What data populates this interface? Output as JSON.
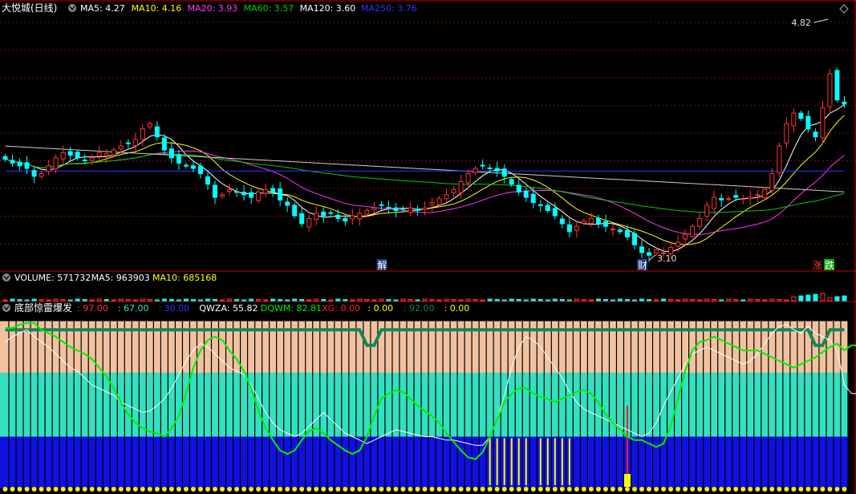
{
  "colors": {
    "ma5": "#ffffff",
    "ma10": "#ffff00",
    "ma20": "#ff33ff",
    "ma60": "#00cc00",
    "ma120": "#cccccc",
    "ma250": "#3333ff",
    "up": "#ff3333",
    "down": "#00ffff",
    "border": "#c00000",
    "peach": "#f2c2a0",
    "teal": "#33e0c0",
    "blue": "#1010e0",
    "qwza": "#ffffff",
    "dqwm": "#00ee00",
    "xg": "#ff2020",
    "flat": "#118855",
    "spike": "#ffff00",
    "dot": "#ffee00"
  },
  "main_panel": {
    "stock_name": "大悦城(日线)",
    "indicators": [
      {
        "label": "MA5: 4.27",
        "color": "#ffffff"
      },
      {
        "label": "MA10: 4.16",
        "color": "#ffff00"
      },
      {
        "label": "MA20: 3.93",
        "color": "#ff33ff"
      },
      {
        "label": "MA60: 3.57",
        "color": "#00cc00"
      },
      {
        "label": "MA120: 3.60",
        "color": "#ffffff"
      },
      {
        "label": "MA250: 3.76",
        "color": "#3333ff"
      }
    ],
    "high_label": "4.82",
    "low_label": "3.10",
    "marker_jie": "解",
    "marker_cai": "财",
    "marker_zhang": "涨",
    "marker_die": "跌"
  },
  "volume_panel": {
    "labels": [
      {
        "label": "VOLUME: 571732",
        "color": "#ffffff"
      },
      {
        "label": "MA5: 963903",
        "color": "#ffffff"
      },
      {
        "label": "MA10: 685168",
        "color": "#ffff00"
      }
    ]
  },
  "indicator_panel": {
    "name": "底部惊雷爆发",
    "labels": [
      {
        "label": ": 97.00",
        "color": "#ff3333"
      },
      {
        "label": ": 67.00",
        "color": "#33e0c0"
      },
      {
        "label": ": 30.00",
        "color": "#3333ff"
      },
      {
        "label": "QWZA: 55.82",
        "color": "#ffffff"
      },
      {
        "label": "DQWM: 82.81",
        "color": "#00ee00"
      },
      {
        "label": "XG: 0.00",
        "color": "#ff2020"
      },
      {
        "label": ": 0.00",
        "color": "#ffff00"
      },
      {
        "label": ": 92.00",
        "color": "#118855"
      },
      {
        "label": ": 0.00",
        "color": "#ffff00"
      }
    ]
  },
  "chart_data": {
    "type": "candlestick",
    "price_range": [
      3.0,
      4.95
    ],
    "indicator_range": [
      0,
      100
    ],
    "levels": [
      97,
      67,
      30
    ],
    "closes": [
      3.85,
      3.82,
      3.8,
      3.78,
      3.72,
      3.74,
      3.8,
      3.86,
      3.9,
      3.88,
      3.86,
      3.84,
      3.86,
      3.9,
      3.89,
      3.92,
      3.95,
      3.97,
      4.0,
      4.08,
      4.12,
      4.02,
      3.92,
      3.86,
      3.82,
      3.8,
      3.78,
      3.74,
      3.66,
      3.56,
      3.58,
      3.62,
      3.6,
      3.58,
      3.56,
      3.6,
      3.62,
      3.6,
      3.54,
      3.5,
      3.42,
      3.36,
      3.4,
      3.44,
      3.42,
      3.44,
      3.4,
      3.38,
      3.42,
      3.44,
      3.46,
      3.48,
      3.5,
      3.48,
      3.46,
      3.47,
      3.48,
      3.46,
      3.48,
      3.52,
      3.55,
      3.58,
      3.62,
      3.68,
      3.74,
      3.78,
      3.8,
      3.78,
      3.76,
      3.72,
      3.66,
      3.6,
      3.56,
      3.52,
      3.5,
      3.46,
      3.42,
      3.36,
      3.3,
      3.34,
      3.38,
      3.4,
      3.36,
      3.34,
      3.32,
      3.3,
      3.26,
      3.2,
      3.14,
      3.12,
      3.16,
      3.14,
      3.18,
      3.22,
      3.28,
      3.34,
      3.4,
      3.5,
      3.56,
      3.54,
      3.55,
      3.56,
      3.55,
      3.56,
      3.58,
      3.62,
      3.74,
      3.95,
      4.12,
      4.2,
      4.16,
      4.08,
      4.02,
      4.24,
      4.5,
      4.3,
      4.27
    ],
    "dqwm": [
      93,
      93,
      95,
      96,
      96,
      92,
      90,
      88,
      85,
      82,
      80,
      78,
      75,
      70,
      65,
      58,
      50,
      43,
      38,
      35,
      33,
      32,
      30,
      35,
      42,
      55,
      70,
      80,
      86,
      88,
      86,
      80,
      75,
      68,
      58,
      45,
      35,
      28,
      22,
      20,
      22,
      28,
      33,
      35,
      32,
      28,
      25,
      22,
      20,
      22,
      30,
      42,
      52,
      55,
      57,
      56,
      52,
      48,
      45,
      42,
      38,
      32,
      27,
      22,
      18,
      17,
      21,
      30,
      40,
      50,
      55,
      58,
      58,
      55,
      53,
      52,
      50,
      52,
      54,
      56,
      57,
      55,
      50,
      43,
      38,
      34,
      30,
      28,
      28,
      26,
      24,
      26,
      36,
      52,
      68,
      80,
      85,
      86,
      88,
      86,
      84,
      82,
      80,
      80,
      80,
      78,
      76,
      74,
      72,
      70,
      72,
      74,
      76,
      79,
      82,
      84,
      80,
      83,
      83
    ],
    "qwza": [
      85,
      88,
      90,
      92,
      88,
      85,
      82,
      78,
      74,
      70,
      68,
      64,
      60,
      58,
      56,
      54,
      50,
      48,
      46,
      44,
      45,
      48,
      52,
      58,
      66,
      74,
      80,
      84,
      82,
      78,
      74,
      70,
      68,
      66,
      60,
      52,
      44,
      38,
      34,
      32,
      30,
      32,
      36,
      40,
      44,
      40,
      36,
      32,
      30,
      28,
      26,
      28,
      30,
      32,
      34,
      33,
      32,
      31,
      30,
      30,
      29,
      28,
      28,
      27,
      26,
      25,
      25,
      30,
      40,
      54,
      70,
      82,
      88,
      86,
      82,
      76,
      70,
      64,
      56,
      50,
      46,
      44,
      42,
      40,
      38,
      36,
      34,
      32,
      30,
      32,
      38,
      48,
      56,
      64,
      72,
      78,
      80,
      82,
      80,
      78,
      76,
      74,
      72,
      74,
      78,
      84,
      90,
      94,
      95,
      92,
      90,
      94,
      90,
      88,
      86,
      80,
      60,
      55,
      55
    ],
    "xg_index": 86,
    "spike_indices": [
      67,
      68,
      69,
      70,
      71,
      72,
      74,
      75,
      76,
      77,
      78
    ]
  }
}
